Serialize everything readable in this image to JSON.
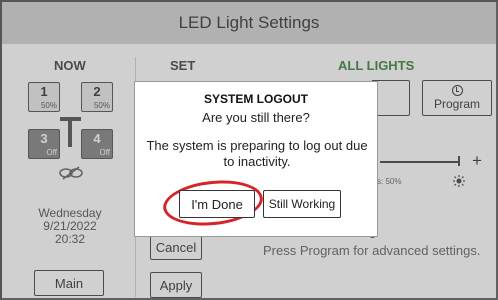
{
  "title": "LED Light Settings",
  "columns": {
    "now": "NOW",
    "set": "SET",
    "all_lights": "ALL LIGHTS"
  },
  "lights": [
    {
      "number": "1",
      "level": "50%"
    },
    {
      "number": "2",
      "level": "50%"
    },
    {
      "number": "3",
      "level": "Off"
    },
    {
      "number": "4",
      "level": "Off"
    }
  ],
  "now_info": {
    "day": "Wednesday",
    "date": "9/21/2022",
    "time": "20:32"
  },
  "buttons": {
    "main": "Main",
    "cancel": "Cancel",
    "apply": "Apply",
    "program": "Program"
  },
  "level_slider": {
    "level_text": "s: 50%",
    "plus": "+"
  },
  "hint": "Press Program for advanced settings.",
  "modal": {
    "title": "SYSTEM LOGOUT",
    "question": "Are you still there?",
    "message": "The system is preparing to log out due to inactivity.",
    "done_button": "I'm Done",
    "still_button": "Still Working"
  },
  "colors": {
    "titlebar": "#cfcfcf",
    "all_lights": "#2a7b23",
    "highlight_ring": "#d5232a"
  }
}
